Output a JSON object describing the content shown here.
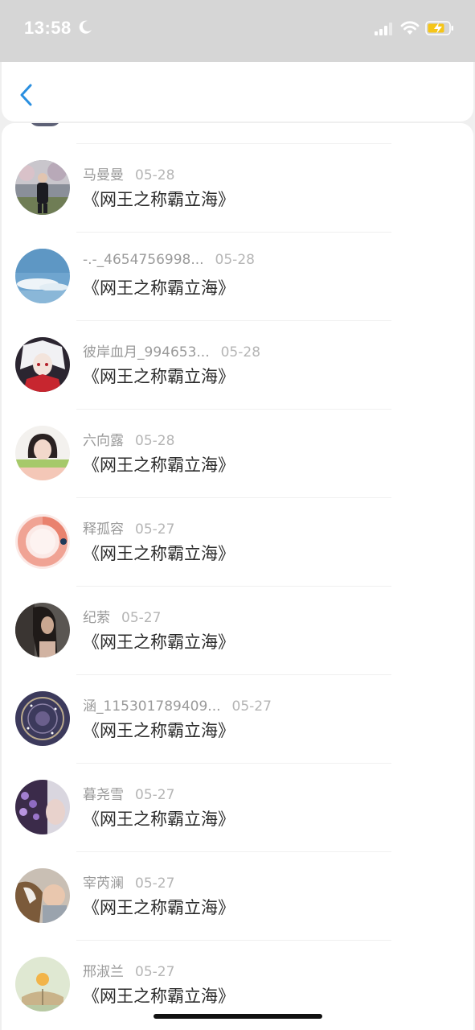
{
  "status_bar": {
    "time": "13:58",
    "icons": [
      "moon-icon",
      "signal-icon",
      "wifi-icon",
      "battery-charging-icon"
    ],
    "battery_color": "#f5c518"
  },
  "header": {
    "back_icon": "chevron-left-icon",
    "accent": "#2a8fe0"
  },
  "items": [
    {
      "name": "马曼曼",
      "date": "05-28",
      "title": "《网王之称霸立海》",
      "avatar": "person-photo"
    },
    {
      "name": "-.-_4654756998...",
      "date": "05-28",
      "title": "《网王之称霸立海》",
      "avatar": "sky-photo"
    },
    {
      "name": "彼岸血月_994653...",
      "date": "05-28",
      "title": "《网王之称霸立海》",
      "avatar": "anime-photo"
    },
    {
      "name": "六向露",
      "date": "05-28",
      "title": "《网王之称霸立海》",
      "avatar": "portrait-photo"
    },
    {
      "name": "释孤容",
      "date": "05-27",
      "title": "《网王之称霸立海》",
      "avatar": "ring-graphic"
    },
    {
      "name": "纪萦",
      "date": "05-27",
      "title": "《网王之称霸立海》",
      "avatar": "dark-hair-photo"
    },
    {
      "name": "涵_115301789409...",
      "date": "05-27",
      "title": "《网王之称霸立海》",
      "avatar": "night-photo"
    },
    {
      "name": "暮尧雪",
      "date": "05-27",
      "title": "《网王之称霸立海》",
      "avatar": "flower-photo"
    },
    {
      "name": "宰芮澜",
      "date": "05-27",
      "title": "《网王之称霸立海》",
      "avatar": "baby-dog-photo"
    },
    {
      "name": "邢淑兰",
      "date": "05-27",
      "title": "《网王之称霸立海》",
      "avatar": "book-photo"
    }
  ]
}
